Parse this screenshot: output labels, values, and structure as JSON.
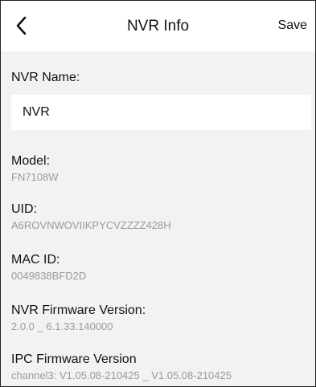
{
  "header": {
    "title": "NVR Info",
    "save_label": "Save"
  },
  "nvr_name": {
    "label": "NVR Name:",
    "value": "NVR"
  },
  "fields": [
    {
      "label": "Model:",
      "value": "FN7108W"
    },
    {
      "label": "UID:",
      "value": "A6ROVNWOVIIKPYCVZZZZ428H"
    },
    {
      "label": "MAC ID:",
      "value": "0049838BFD2D"
    },
    {
      "label": "NVR Firmware Version:",
      "value": "2.0.0 _ 6.1.33.140000"
    },
    {
      "label": "IPC Firmware Version",
      "value": "channel3: V1.05.08-210425 _ V1.05.08-210425"
    }
  ],
  "icons": {
    "back": "chevron-left-icon"
  },
  "colors": {
    "background": "#f2f2f2",
    "card": "#ffffff",
    "text": "#111111",
    "muted_text": "#9a9a9a"
  }
}
